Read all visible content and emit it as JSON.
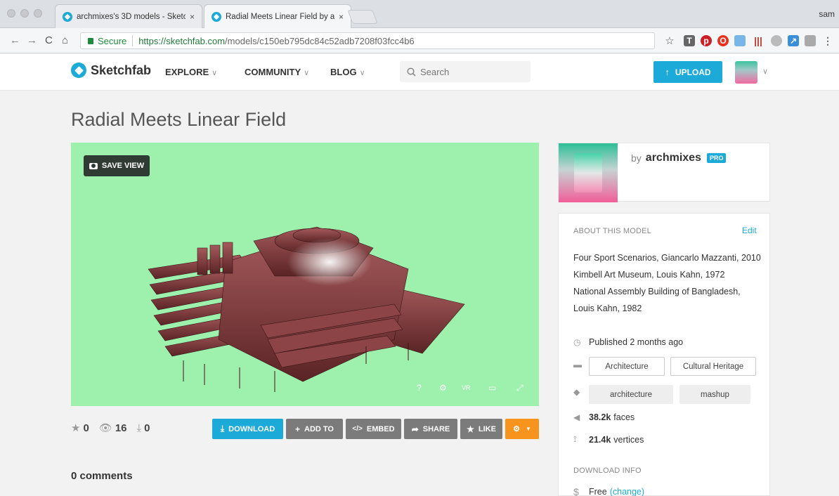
{
  "browser": {
    "tabs": [
      {
        "title": "archmixes's 3D models - Sketc",
        "close": "×"
      },
      {
        "title": "Radial Meets Linear Field by ar",
        "close": "×"
      }
    ],
    "user": "sam",
    "secure_label": "Secure",
    "url_host": "https://sketchfab.com",
    "url_path": "/models/c150eb795dc84c52adb7208f03fcc4b6",
    "nav": {
      "back": "←",
      "forward": "→",
      "reload": "C",
      "home": "⌂"
    },
    "extensions": [
      "star-icon",
      "t-icon",
      "pinterest-icon",
      "opera-icon",
      "doc-icon",
      "bars-icon",
      "cloud-icon",
      "arrow-icon",
      "camera-icon",
      "menu-icon"
    ]
  },
  "header": {
    "logo": "Sketchfab",
    "nav": [
      {
        "label": "EXPLORE",
        "chev": "∨"
      },
      {
        "label": "COMMUNITY",
        "chev": "∨"
      },
      {
        "label": "BLOG",
        "chev": "∨"
      }
    ],
    "search_placeholder": "Search",
    "upload_label": "UPLOAD",
    "avatar_chev": "∨"
  },
  "model": {
    "title": "Radial Meets Linear Field",
    "save_view": "SAVE VIEW",
    "viewer_controls": [
      "?",
      "⚙",
      "VR",
      "▭",
      "⤢"
    ],
    "stats": {
      "likes": "0",
      "views": "16",
      "downloads": "0"
    },
    "actions": {
      "download": "DOWNLOAD",
      "add_to": "ADD TO",
      "embed": "EMBED",
      "share": "SHARE",
      "like": "LIKE"
    },
    "comments": "0 comments"
  },
  "author": {
    "by": "by",
    "name": "archmixes",
    "badge": "PRO"
  },
  "about": {
    "heading": "ABOUT THIS MODEL",
    "edit": "Edit",
    "description": [
      "Four Sport Scenarios, Giancarlo Mazzanti, 2010",
      "Kimbell Art Museum, Louis Kahn, 1972",
      "National Assembly Building of Bangladesh,",
      "Louis Kahn, 1982"
    ],
    "published": "Published 2 months ago",
    "categories": [
      "Architecture",
      "Cultural Heritage"
    ],
    "tags": [
      "architecture",
      "mashup"
    ],
    "faces_value": "38.2k",
    "faces_label": "faces",
    "vertices_value": "21.4k",
    "vertices_label": "vertices",
    "download_heading": "DOWNLOAD INFO",
    "price": "Free",
    "change": "(change)"
  },
  "colors": {
    "accent": "#1caad9",
    "viewer_bg": "#9ef0ad",
    "model": "#7a3a3c",
    "orange": "#f7941e",
    "grey_button": "#7b7b7b"
  }
}
